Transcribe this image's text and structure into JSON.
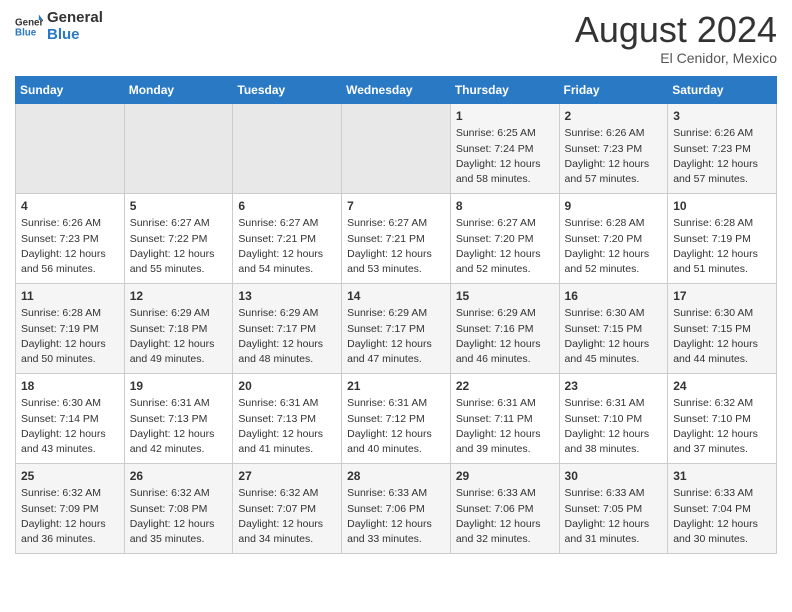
{
  "header": {
    "logo_line1": "General",
    "logo_line2": "Blue",
    "month_year": "August 2024",
    "location": "El Cenidor, Mexico"
  },
  "days_of_week": [
    "Sunday",
    "Monday",
    "Tuesday",
    "Wednesday",
    "Thursday",
    "Friday",
    "Saturday"
  ],
  "weeks": [
    [
      {
        "day": "",
        "empty": true
      },
      {
        "day": "",
        "empty": true
      },
      {
        "day": "",
        "empty": true
      },
      {
        "day": "",
        "empty": true
      },
      {
        "day": "1",
        "line1": "Sunrise: 6:25 AM",
        "line2": "Sunset: 7:24 PM",
        "line3": "Daylight: 12 hours",
        "line4": "and 58 minutes."
      },
      {
        "day": "2",
        "line1": "Sunrise: 6:26 AM",
        "line2": "Sunset: 7:23 PM",
        "line3": "Daylight: 12 hours",
        "line4": "and 57 minutes."
      },
      {
        "day": "3",
        "line1": "Sunrise: 6:26 AM",
        "line2": "Sunset: 7:23 PM",
        "line3": "Daylight: 12 hours",
        "line4": "and 57 minutes."
      }
    ],
    [
      {
        "day": "4",
        "line1": "Sunrise: 6:26 AM",
        "line2": "Sunset: 7:23 PM",
        "line3": "Daylight: 12 hours",
        "line4": "and 56 minutes."
      },
      {
        "day": "5",
        "line1": "Sunrise: 6:27 AM",
        "line2": "Sunset: 7:22 PM",
        "line3": "Daylight: 12 hours",
        "line4": "and 55 minutes."
      },
      {
        "day": "6",
        "line1": "Sunrise: 6:27 AM",
        "line2": "Sunset: 7:21 PM",
        "line3": "Daylight: 12 hours",
        "line4": "and 54 minutes."
      },
      {
        "day": "7",
        "line1": "Sunrise: 6:27 AM",
        "line2": "Sunset: 7:21 PM",
        "line3": "Daylight: 12 hours",
        "line4": "and 53 minutes."
      },
      {
        "day": "8",
        "line1": "Sunrise: 6:27 AM",
        "line2": "Sunset: 7:20 PM",
        "line3": "Daylight: 12 hours",
        "line4": "and 52 minutes."
      },
      {
        "day": "9",
        "line1": "Sunrise: 6:28 AM",
        "line2": "Sunset: 7:20 PM",
        "line3": "Daylight: 12 hours",
        "line4": "and 52 minutes."
      },
      {
        "day": "10",
        "line1": "Sunrise: 6:28 AM",
        "line2": "Sunset: 7:19 PM",
        "line3": "Daylight: 12 hours",
        "line4": "and 51 minutes."
      }
    ],
    [
      {
        "day": "11",
        "line1": "Sunrise: 6:28 AM",
        "line2": "Sunset: 7:19 PM",
        "line3": "Daylight: 12 hours",
        "line4": "and 50 minutes."
      },
      {
        "day": "12",
        "line1": "Sunrise: 6:29 AM",
        "line2": "Sunset: 7:18 PM",
        "line3": "Daylight: 12 hours",
        "line4": "and 49 minutes."
      },
      {
        "day": "13",
        "line1": "Sunrise: 6:29 AM",
        "line2": "Sunset: 7:17 PM",
        "line3": "Daylight: 12 hours",
        "line4": "and 48 minutes."
      },
      {
        "day": "14",
        "line1": "Sunrise: 6:29 AM",
        "line2": "Sunset: 7:17 PM",
        "line3": "Daylight: 12 hours",
        "line4": "and 47 minutes."
      },
      {
        "day": "15",
        "line1": "Sunrise: 6:29 AM",
        "line2": "Sunset: 7:16 PM",
        "line3": "Daylight: 12 hours",
        "line4": "and 46 minutes."
      },
      {
        "day": "16",
        "line1": "Sunrise: 6:30 AM",
        "line2": "Sunset: 7:15 PM",
        "line3": "Daylight: 12 hours",
        "line4": "and 45 minutes."
      },
      {
        "day": "17",
        "line1": "Sunrise: 6:30 AM",
        "line2": "Sunset: 7:15 PM",
        "line3": "Daylight: 12 hours",
        "line4": "and 44 minutes."
      }
    ],
    [
      {
        "day": "18",
        "line1": "Sunrise: 6:30 AM",
        "line2": "Sunset: 7:14 PM",
        "line3": "Daylight: 12 hours",
        "line4": "and 43 minutes."
      },
      {
        "day": "19",
        "line1": "Sunrise: 6:31 AM",
        "line2": "Sunset: 7:13 PM",
        "line3": "Daylight: 12 hours",
        "line4": "and 42 minutes."
      },
      {
        "day": "20",
        "line1": "Sunrise: 6:31 AM",
        "line2": "Sunset: 7:13 PM",
        "line3": "Daylight: 12 hours",
        "line4": "and 41 minutes."
      },
      {
        "day": "21",
        "line1": "Sunrise: 6:31 AM",
        "line2": "Sunset: 7:12 PM",
        "line3": "Daylight: 12 hours",
        "line4": "and 40 minutes."
      },
      {
        "day": "22",
        "line1": "Sunrise: 6:31 AM",
        "line2": "Sunset: 7:11 PM",
        "line3": "Daylight: 12 hours",
        "line4": "and 39 minutes."
      },
      {
        "day": "23",
        "line1": "Sunrise: 6:31 AM",
        "line2": "Sunset: 7:10 PM",
        "line3": "Daylight: 12 hours",
        "line4": "and 38 minutes."
      },
      {
        "day": "24",
        "line1": "Sunrise: 6:32 AM",
        "line2": "Sunset: 7:10 PM",
        "line3": "Daylight: 12 hours",
        "line4": "and 37 minutes."
      }
    ],
    [
      {
        "day": "25",
        "line1": "Sunrise: 6:32 AM",
        "line2": "Sunset: 7:09 PM",
        "line3": "Daylight: 12 hours",
        "line4": "and 36 minutes."
      },
      {
        "day": "26",
        "line1": "Sunrise: 6:32 AM",
        "line2": "Sunset: 7:08 PM",
        "line3": "Daylight: 12 hours",
        "line4": "and 35 minutes."
      },
      {
        "day": "27",
        "line1": "Sunrise: 6:32 AM",
        "line2": "Sunset: 7:07 PM",
        "line3": "Daylight: 12 hours",
        "line4": "and 34 minutes."
      },
      {
        "day": "28",
        "line1": "Sunrise: 6:33 AM",
        "line2": "Sunset: 7:06 PM",
        "line3": "Daylight: 12 hours",
        "line4": "and 33 minutes."
      },
      {
        "day": "29",
        "line1": "Sunrise: 6:33 AM",
        "line2": "Sunset: 7:06 PM",
        "line3": "Daylight: 12 hours",
        "line4": "and 32 minutes."
      },
      {
        "day": "30",
        "line1": "Sunrise: 6:33 AM",
        "line2": "Sunset: 7:05 PM",
        "line3": "Daylight: 12 hours",
        "line4": "and 31 minutes."
      },
      {
        "day": "31",
        "line1": "Sunrise: 6:33 AM",
        "line2": "Sunset: 7:04 PM",
        "line3": "Daylight: 12 hours",
        "line4": "and 30 minutes."
      }
    ]
  ]
}
